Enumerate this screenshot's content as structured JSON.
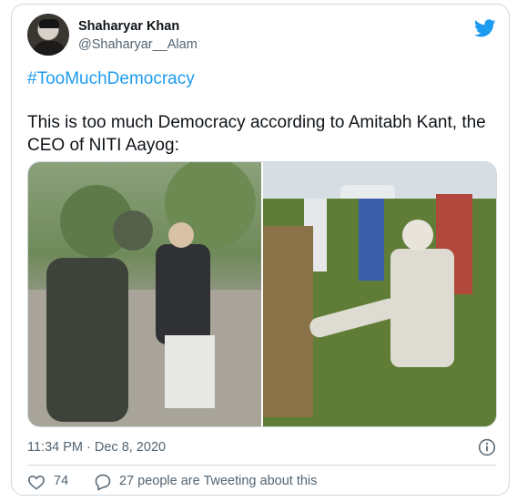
{
  "author": {
    "name": "Shaharyar Khan",
    "handle": "@Shaharyar__Alam"
  },
  "tweet": {
    "hashtag": "#TooMuchDemocracy",
    "text": "This is too much Democracy according to Amitabh Kant, the CEO of NITI Aayog:",
    "timestamp": "11:34 PM · Dec 8, 2020"
  },
  "engagement": {
    "likes": "74",
    "discussion": "27 people are Tweeting about this"
  },
  "icons": {
    "brand": "twitter-bird-icon",
    "info": "info-icon",
    "like": "heart-icon",
    "reply": "reply-bubble-icon"
  },
  "colors": {
    "accent": "#1d9bf0",
    "muted": "#536471",
    "border": "#cfd9de"
  }
}
